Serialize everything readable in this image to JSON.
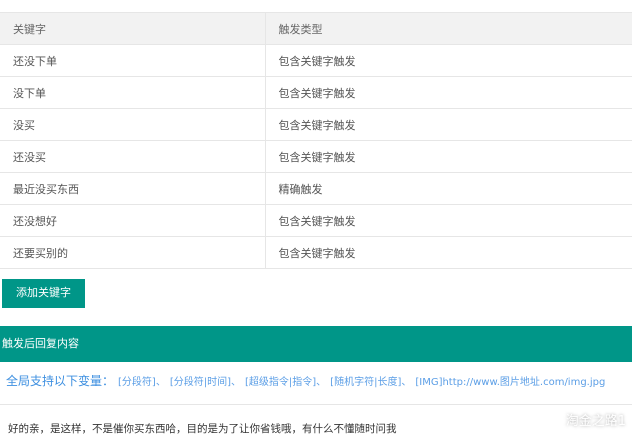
{
  "table": {
    "headers": {
      "keyword": "关键字",
      "trigger_type": "触发类型"
    },
    "rows": [
      {
        "keyword": "还没下单",
        "trigger": "包含关键字触发"
      },
      {
        "keyword": "没下单",
        "trigger": "包含关键字触发"
      },
      {
        "keyword": "没买",
        "trigger": "包含关键字触发"
      },
      {
        "keyword": "还没买",
        "trigger": "包含关键字触发"
      },
      {
        "keyword": "最近没买东西",
        "trigger": "精确触发"
      },
      {
        "keyword": "还没想好",
        "trigger": "包含关键字触发"
      },
      {
        "keyword": "还要买别的",
        "trigger": "包含关键字触发"
      }
    ]
  },
  "add_button_label": "添加关键字",
  "reply_section": {
    "header": "触发后回复内容",
    "vars_lead": "全局支持以下变量：",
    "vars": [
      "[分段符]、",
      "[分段符|时间]、",
      "[超级指令|指令]、",
      "[随机字符|长度]、",
      "[IMG]http://www.图片地址.com/img.jpg"
    ],
    "reply_text": "好的亲，是这样，不是催你买东西哈，目的是为了让你省钱哦，有什么不懂随时问我"
  },
  "watermark": {
    "text": "淘金之路1",
    "icon": "wechat-official-icon"
  },
  "colors": {
    "accent": "#009688",
    "link_blue": "#4a90e2",
    "header_bg": "#f2f2f2",
    "border": "#e6e6e6"
  }
}
